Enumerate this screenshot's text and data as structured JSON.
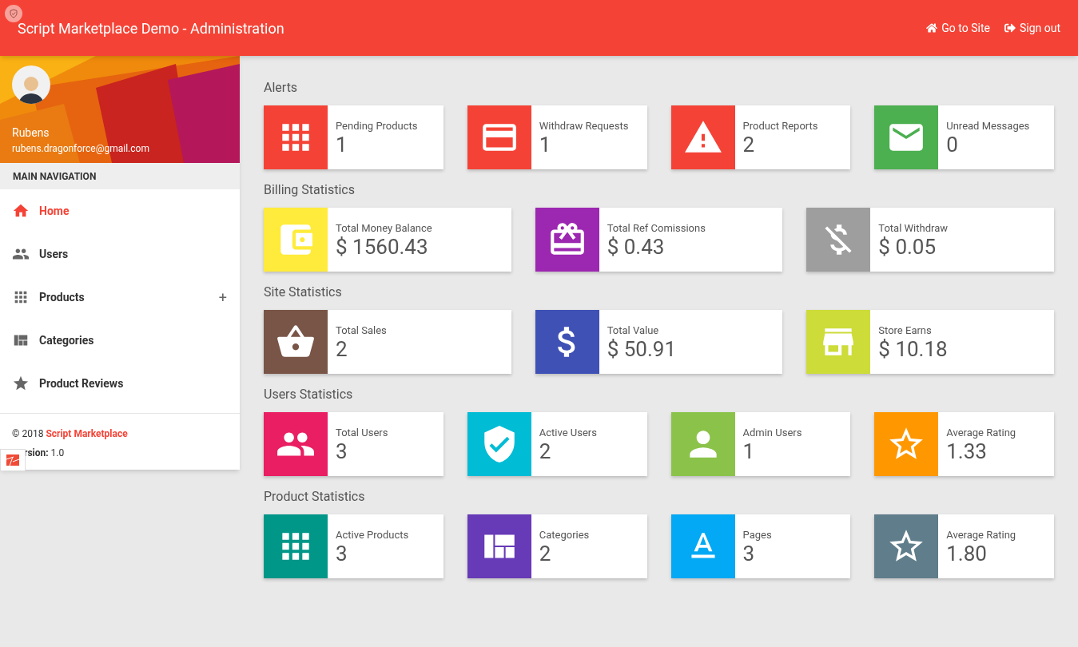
{
  "header": {
    "title": "Script Marketplace Demo - Administration",
    "links": [
      "Go to Site",
      "Sign out"
    ]
  },
  "sidebar": {
    "user": {
      "name": "Rubens",
      "email": "rubens.dragonforce@gmail.com"
    },
    "nav_heading": "MAIN NAVIGATION",
    "items": [
      {
        "label": "Home",
        "selected": true
      },
      {
        "label": "Users",
        "selected": false
      },
      {
        "label": "Products",
        "selected": false,
        "expand_mark": "+"
      },
      {
        "label": "Categories",
        "selected": false
      },
      {
        "label": "Product Reviews",
        "selected": false
      }
    ],
    "footer": {
      "copyright": "© 2018",
      "brand": "Script Marketplace",
      "version_label": "rsion:",
      "version": "1.0"
    }
  },
  "sections": [
    {
      "title": "Alerts",
      "cards": [
        {
          "label": "Pending Products",
          "value": "1",
          "color": "#f44336"
        },
        {
          "label": "Withdraw Requests",
          "value": "1",
          "color": "#f44336"
        },
        {
          "label": "Product Reports",
          "value": "2",
          "color": "#f44336"
        },
        {
          "label": "Unread Messages",
          "value": "0",
          "color": "#4caf50"
        }
      ]
    },
    {
      "title": "Billing Statistics",
      "cards": [
        {
          "label": "Total Money Balance",
          "value": "$ 1560.43",
          "color": "#ffeb3b"
        },
        {
          "label": "Total Ref Comissions",
          "value": "$ 0.43",
          "color": "#9c27b0"
        },
        {
          "label": "Total Withdraw",
          "value": "$ 0.05",
          "color": "#9e9e9e"
        }
      ]
    },
    {
      "title": "Site Statistics",
      "cards": [
        {
          "label": "Total Sales",
          "value": "2",
          "color": "#795548"
        },
        {
          "label": "Total Value",
          "value": "$ 50.91",
          "color": "#3f51b5"
        },
        {
          "label": "Store Earns",
          "value": "$ 10.18",
          "color": "#cddc39"
        }
      ]
    },
    {
      "title": "Users Statistics",
      "cards": [
        {
          "label": "Total Users",
          "value": "3",
          "color": "#e91e63"
        },
        {
          "label": "Active Users",
          "value": "2",
          "color": "#00bcd4"
        },
        {
          "label": "Admin Users",
          "value": "1",
          "color": "#8bc34a"
        },
        {
          "label": "Average Rating",
          "value": "1.33",
          "color": "#ff9800"
        }
      ]
    },
    {
      "title": "Product Statistics",
      "cards": [
        {
          "label": "Active Products",
          "value": "3",
          "color": "#009688"
        },
        {
          "label": "Categories",
          "value": "2",
          "color": "#673ab7"
        },
        {
          "label": "Pages",
          "value": "3",
          "color": "#03a9f4"
        },
        {
          "label": "Average Rating",
          "value": "1.80",
          "color": "#607d8b"
        }
      ]
    }
  ]
}
